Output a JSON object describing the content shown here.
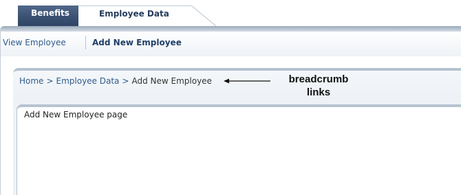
{
  "tabs": [
    {
      "label": "Benefits",
      "active": false
    },
    {
      "label": "Employee Data",
      "active": true
    }
  ],
  "subnav": {
    "items": [
      {
        "label": "View Employee",
        "active": false
      },
      {
        "label": "Add New Employee",
        "active": true
      }
    ]
  },
  "breadcrumb": {
    "items": [
      "Home",
      "Employee Data",
      "Add New Employee"
    ],
    "separator": ">"
  },
  "annotation": {
    "line1": "breadcrumb",
    "line2": "links"
  },
  "content": {
    "title": "Add New Employee page"
  },
  "colors": {
    "tab_dark": "#3a5173",
    "link": "#2e5b8b",
    "panel_border": "#b6c2d0"
  }
}
